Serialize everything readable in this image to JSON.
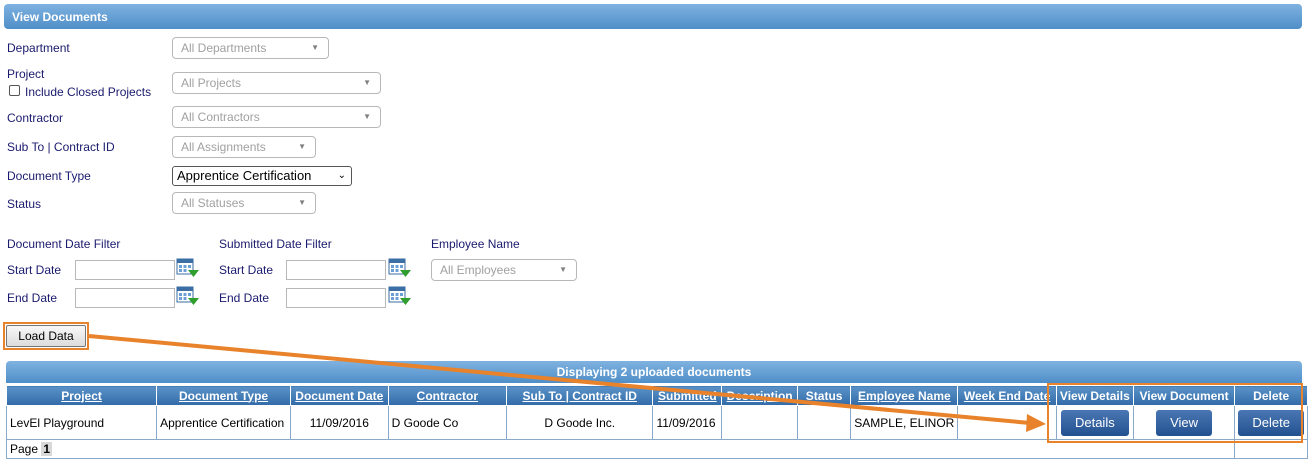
{
  "panel": {
    "title": "View Documents"
  },
  "filters": {
    "department": {
      "label": "Department",
      "value": "All Departments"
    },
    "project": {
      "label": "Project",
      "value": "All Projects",
      "include_closed_label": "Include Closed Projects"
    },
    "contractor": {
      "label": "Contractor",
      "value": "All Contractors"
    },
    "sub_to": {
      "label": "Sub To | Contract ID",
      "value": "All Assignments"
    },
    "document_type": {
      "label": "Document Type",
      "value": "Apprentice Certification"
    },
    "status": {
      "label": "Status",
      "value": "All Statuses"
    }
  },
  "date_filters": {
    "document": {
      "title": "Document Date Filter",
      "start_label": "Start Date",
      "end_label": "End Date"
    },
    "submitted": {
      "title": "Submitted Date Filter",
      "start_label": "Start Date",
      "end_label": "End Date"
    },
    "employee": {
      "title": "Employee Name",
      "value": "All Employees"
    }
  },
  "load_button": "Load Data",
  "grid": {
    "caption": "Displaying 2 uploaded documents",
    "headers": [
      "Project",
      "Document Type",
      "Document Date",
      "Contractor",
      "Sub To | Contract ID",
      "Submitted",
      "Description",
      "Status",
      "Employee Name",
      "Week End Date",
      "View Details",
      "View Document",
      "Delete"
    ],
    "rows": [
      {
        "project": "LevEl Playground",
        "document_type": "Apprentice Certification",
        "document_date": "11/09/2016",
        "contractor": "D Goode Co",
        "sub_to": "D Goode Inc.",
        "submitted": "11/09/2016",
        "description": "",
        "status": "",
        "employee": "SAMPLE, ELINOR",
        "week_end": "",
        "details_btn": "Details",
        "view_btn": "View",
        "delete_btn": "Delete"
      }
    ],
    "pager": {
      "label": "Page",
      "current": "1"
    }
  },
  "colors": {
    "annotation": "#e8822b",
    "header_blue": "#336ba8"
  }
}
